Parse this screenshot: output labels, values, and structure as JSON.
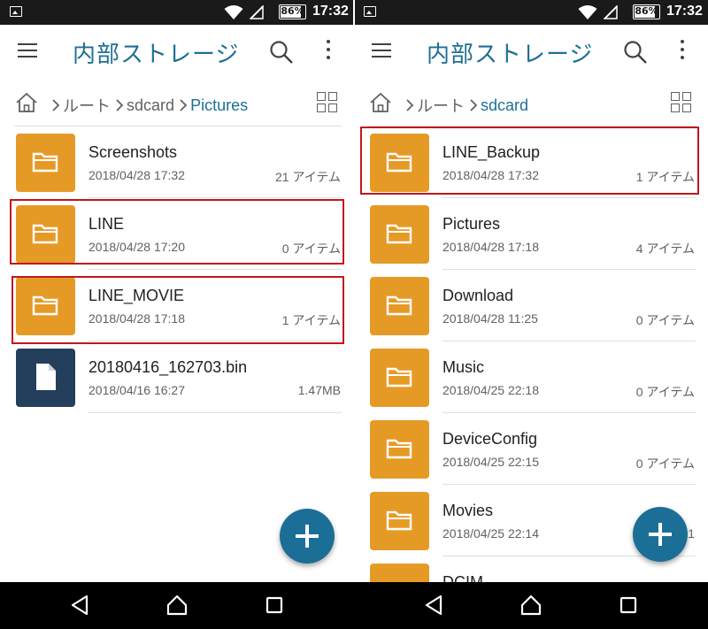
{
  "status_bar": {
    "battery": "86%",
    "battery_level": 0.86,
    "time": "17:32"
  },
  "left": {
    "toolbar": {
      "title": "内部ストレージ"
    },
    "breadcrumb": [
      "ルート",
      "sdcard",
      "Pictures"
    ],
    "files": [
      {
        "name": "Screenshots",
        "date": "2018/04/28 17:32",
        "meta": "21 アイテム",
        "type": "folder"
      },
      {
        "name": "LINE",
        "date": "2018/04/28 17:20",
        "meta": "0 アイテム",
        "type": "folder"
      },
      {
        "name": "LINE_MOVIE",
        "date": "2018/04/28 17:18",
        "meta": "1 アイテム",
        "type": "folder"
      },
      {
        "name": "20180416_162703.bin",
        "date": "2018/04/16 16:27",
        "meta": "1.47MB",
        "type": "file"
      }
    ]
  },
  "right": {
    "toolbar": {
      "title": "内部ストレージ"
    },
    "breadcrumb": [
      "ルート",
      "sdcard"
    ],
    "files": [
      {
        "name": "LINE_Backup",
        "date": "2018/04/28 17:32",
        "meta": "1 アイテム",
        "type": "folder"
      },
      {
        "name": "Pictures",
        "date": "2018/04/28 17:18",
        "meta": "4 アイテム",
        "type": "folder"
      },
      {
        "name": "Download",
        "date": "2018/04/28 11:25",
        "meta": "0 アイテム",
        "type": "folder"
      },
      {
        "name": "Music",
        "date": "2018/04/25 22:18",
        "meta": "0 アイテム",
        "type": "folder"
      },
      {
        "name": "DeviceConfig",
        "date": "2018/04/25 22:15",
        "meta": "0 アイテム",
        "type": "folder"
      },
      {
        "name": "Movies",
        "date": "2018/04/25 22:14",
        "meta": "1",
        "type": "folder"
      },
      {
        "name": "DCIM",
        "date": "",
        "meta": "",
        "type": "folder"
      }
    ]
  },
  "colors": {
    "accent": "#1e6f95",
    "folder": "#e69a26",
    "file": "#243f5c",
    "highlight": "#c0181c"
  },
  "icons": {
    "status": [
      "image-icon",
      "wifi-icon",
      "signal-icon",
      "battery-icon"
    ],
    "toolbar": [
      "menu-icon",
      "search-icon",
      "more-vert-icon"
    ],
    "breadcrumb": [
      "home-icon",
      "chevron-right-icon",
      "grid-view-icon"
    ],
    "fab": "add-icon",
    "nav": [
      "back-icon",
      "home-icon",
      "recents-icon"
    ]
  }
}
